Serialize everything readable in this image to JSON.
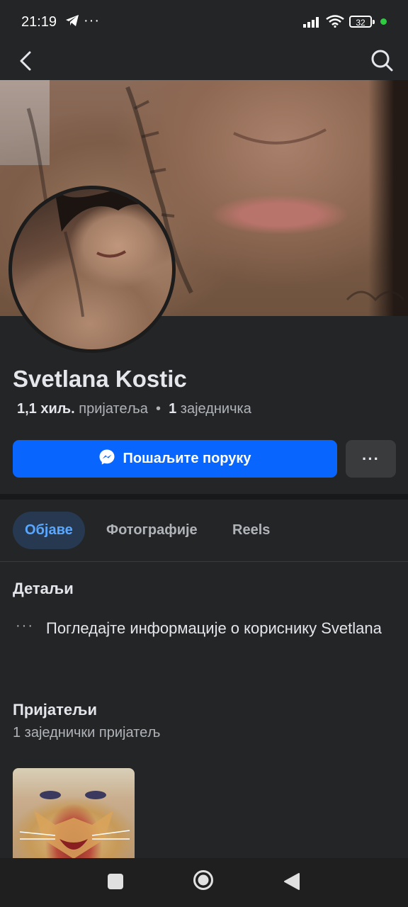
{
  "status_bar": {
    "time": "21:19",
    "battery": "32",
    "telegram_icon": "telegram-icon",
    "overflow": "···"
  },
  "top_nav": {
    "back_icon": "back-arrow-icon",
    "search_icon": "search-icon"
  },
  "profile": {
    "name": "Svetlana Kostic",
    "friends_count": "1,1 хиљ.",
    "friends_label": "пријатеља",
    "separator": "•",
    "mutual_count": "1",
    "mutual_label": "заједничка"
  },
  "actions": {
    "message_label": "Пошаљите поруку",
    "more_label": "···"
  },
  "tabs": [
    {
      "label": "Објаве",
      "active": true
    },
    {
      "label": "Фотографије",
      "active": false
    },
    {
      "label": "Reels",
      "active": false
    }
  ],
  "details": {
    "heading": "Детаљи",
    "dots": "···",
    "info_text": "Погледајте информације о кориснику Svetlana"
  },
  "friends_section": {
    "heading": "Пријатељи",
    "subtitle": "1 заједнички пријатељ"
  },
  "colors": {
    "accent": "#0866ff",
    "background": "#242526",
    "active_tab_bg": "#263951",
    "active_tab_text": "#5aa7ff"
  }
}
